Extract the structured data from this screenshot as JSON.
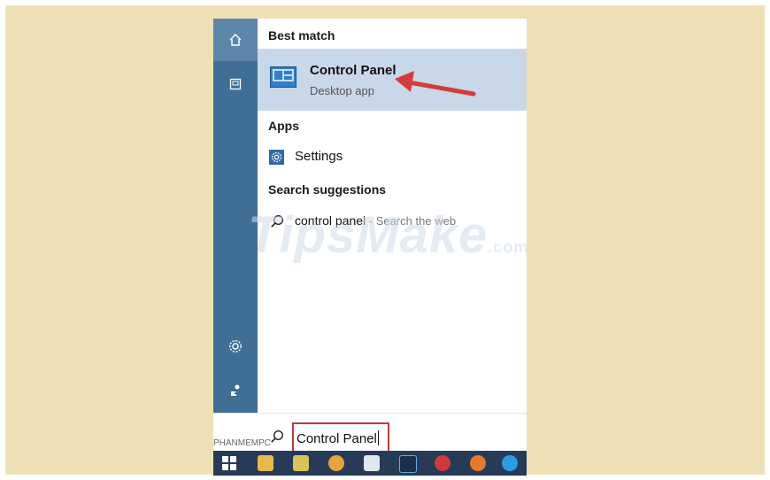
{
  "search_results": {
    "best_match_header": "Best match",
    "best_match": {
      "name": "Control Panel",
      "subtitle": "Desktop app",
      "icon": "control-panel-icon"
    },
    "apps_header": "Apps",
    "apps": [
      {
        "label": "Settings",
        "icon": "gear-icon"
      }
    ],
    "suggestions_header": "Search suggestions",
    "suggestions": [
      {
        "query": "control panel",
        "suffix": " - Search the web",
        "icon": "search-icon"
      }
    ]
  },
  "search_box": {
    "value": "Control Panel",
    "icon": "search-icon"
  },
  "rail_icons": [
    "home-icon",
    "notebook-icon",
    "gear-icon",
    "feedback-icon"
  ],
  "taskbar": {
    "label": "PHANMEMPC",
    "apps": [
      "start-icon",
      "file-explorer-icon",
      "app-icon",
      "chrome-icon",
      "mail-icon",
      "photoshop-icon",
      "opera-icon",
      "firefox-icon",
      "skype-icon"
    ]
  },
  "watermark": {
    "brand": "TipsMake",
    "suffix": ".com"
  },
  "colors": {
    "accent_red": "#c63a3a",
    "selection": "#c8d8e8",
    "rail": "#3f6f95",
    "taskbar": "#263b58",
    "background": "#efe0b5"
  }
}
